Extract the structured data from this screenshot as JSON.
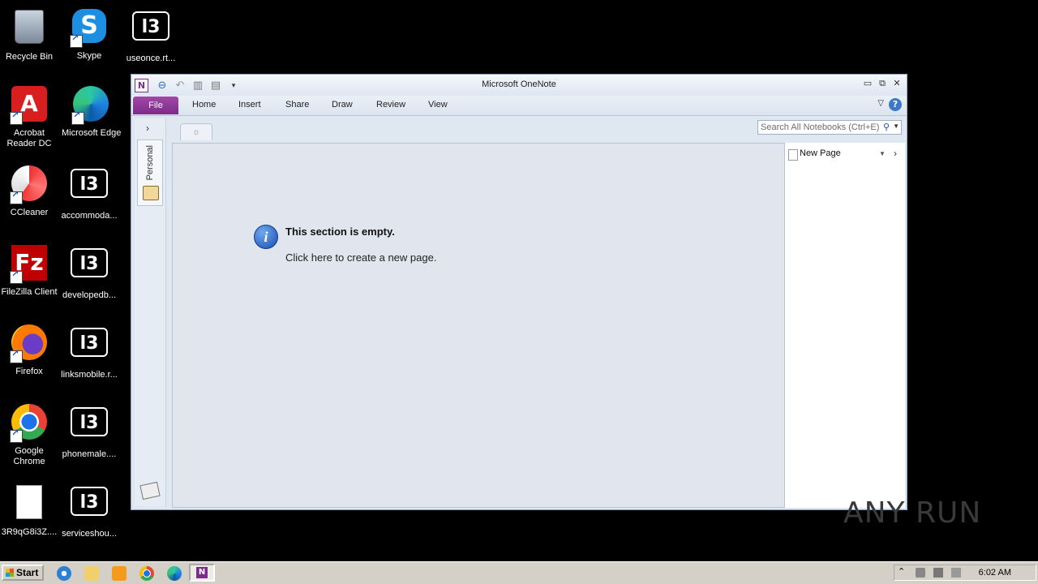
{
  "desktop": {
    "icons": [
      {
        "label": "Recycle Bin"
      },
      {
        "label": "Skype"
      },
      {
        "label": "useonce.rt..."
      },
      {
        "label": "Acrobat Reader DC"
      },
      {
        "label": "Microsoft Edge"
      },
      {
        "label": "CCleaner"
      },
      {
        "label": "accommoda..."
      },
      {
        "label": "FileZilla Client"
      },
      {
        "label": "developedb..."
      },
      {
        "label": "Firefox"
      },
      {
        "label": "linksmobile.r..."
      },
      {
        "label": "Google Chrome"
      },
      {
        "label": "phonemale...."
      },
      {
        "label": "3R9qG8i3Z...."
      },
      {
        "label": "serviceshou..."
      }
    ]
  },
  "window": {
    "title": "Microsoft OneNote",
    "app_icon": "N",
    "tabs": [
      "File",
      "Home",
      "Insert",
      "Share",
      "Draw",
      "Review",
      "View"
    ],
    "help": "?",
    "search_placeholder": "Search All Notebooks (Ctrl+E)",
    "notebook": "Personal",
    "empty_title": "This section is empty.",
    "empty_link": "Click here to create a new page.",
    "page": "New Page"
  },
  "taskbar": {
    "start": "Start",
    "clock": "6:02 AM"
  },
  "watermark": "ANY RUN",
  "colors": {
    "onenote_purple": "#7b2c8a",
    "window_bg": "#dfe7f1",
    "canvas_bg": "#e1e6ee"
  }
}
